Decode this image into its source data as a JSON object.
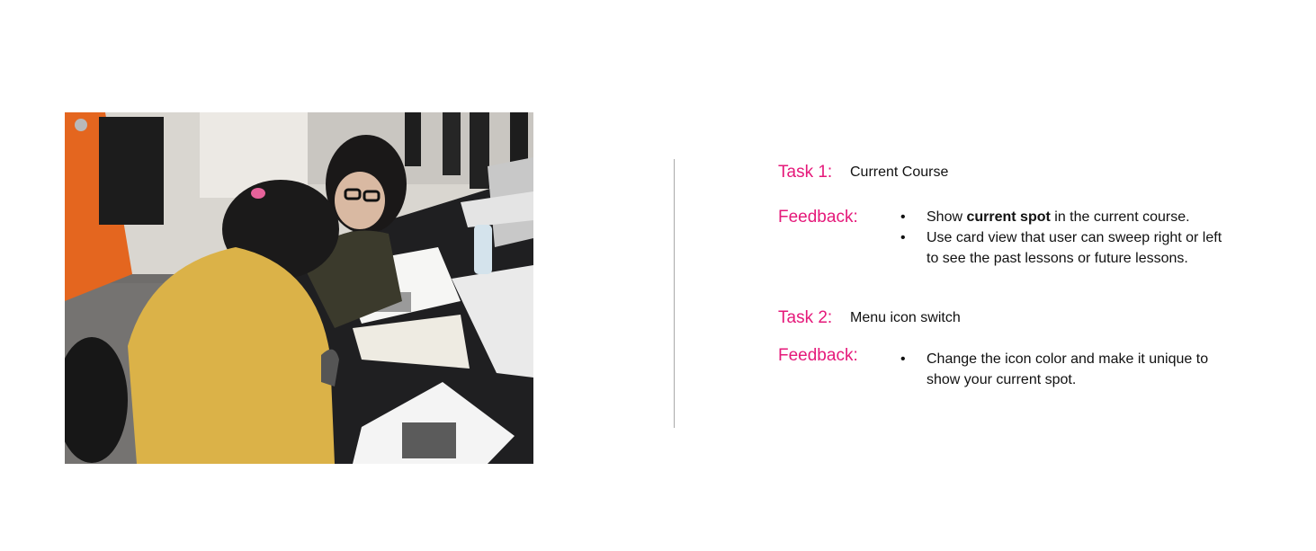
{
  "photo": {
    "alt": "Two people reviewing paper prototypes at a desk"
  },
  "task1": {
    "label": "Task 1:",
    "title": "Current Course",
    "feedback_label": "Feedback:",
    "items": [
      {
        "before": "Show ",
        "bold": "current spot",
        "after": " in the current course."
      },
      {
        "text_line1": "Use card view that user can sweep right or left",
        "text_line2": "to see the past lessons or future lessons."
      }
    ]
  },
  "task2": {
    "label": "Task 2:",
    "title": "Menu icon switch",
    "feedback_label": "Feedback:",
    "items": [
      {
        "text_line1": "Change the icon color and make it unique to",
        "text_line2": "show your current spot."
      }
    ]
  },
  "bullet_char": "•",
  "colors": {
    "accent": "#e5197a",
    "divider": "#a9a9a9"
  }
}
